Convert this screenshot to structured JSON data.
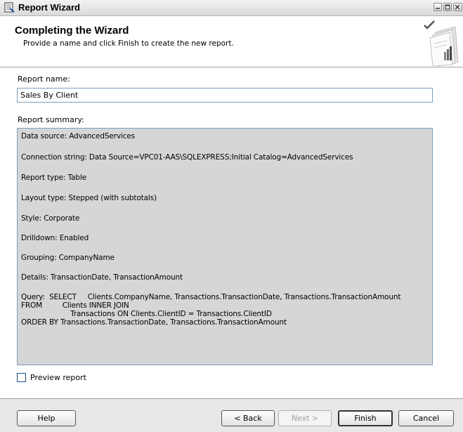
{
  "window": {
    "title": "Report Wizard"
  },
  "header": {
    "title": "Completing the Wizard",
    "subtitle": "Provide a name and click Finish to create the new report."
  },
  "report_name": {
    "label": "Report name:",
    "value": "Sales By Client"
  },
  "summary": {
    "label": "Report summary:",
    "lines": [
      "Data source: AdvancedServices",
      "Connection string: Data Source=VPC01-AAS\\SQLEXPRESS;Initial Catalog=AdvancedServices",
      "Report type: Table",
      "Layout type: Stepped (with subtotals)",
      "Style: Corporate",
      "Drilldown: Enabled",
      "Grouping: CompanyName",
      "Details: TransactionDate, TransactionAmount",
      "Query:  SELECT     Clients.CompanyName, Transactions.TransactionDate, Transactions.TransactionAmount",
      "FROM         Clients INNER JOIN",
      "                      Transactions ON Clients.ClientID = Transactions.ClientID",
      "ORDER BY Transactions.TransactionDate, Transactions.TransactionAmount"
    ]
  },
  "preview": {
    "label": "Preview report",
    "checked": false
  },
  "buttons": {
    "help": "Help",
    "back": "< Back",
    "next": "Next >",
    "finish": "Finish",
    "cancel": "Cancel"
  },
  "icons": {
    "app": "report-wizard-icon",
    "header_graphic": "wizard-checkmark-graphic",
    "minimize": "minimize-icon",
    "maximize": "maximize-icon",
    "close": "close-icon"
  }
}
